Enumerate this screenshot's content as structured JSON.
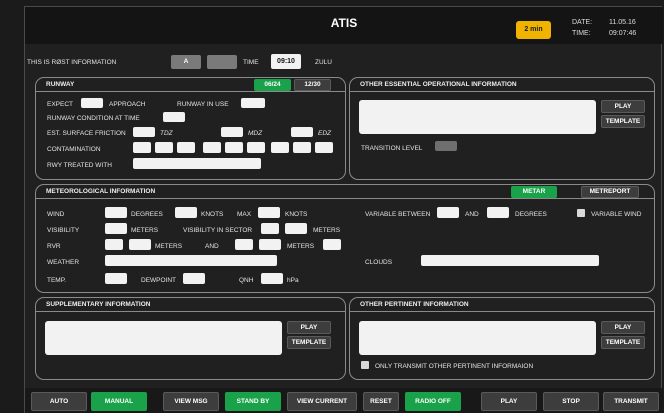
{
  "title": "ATIS",
  "badge": "2 min",
  "date_label": "DATE:",
  "date_value": "11.05.16",
  "time_label": "TIME:",
  "time_value": "09:07:46",
  "info_row": {
    "prefix": "THIS IS RØST INFORMATION",
    "info_letter": "A",
    "time_label": "TIME",
    "time_value": "09:10",
    "zulu": "ZULU"
  },
  "runway": {
    "title": "RUNWAY",
    "rwy_a": "06/24",
    "rwy_b": "12/30",
    "expect": "EXPECT",
    "approach": "APPROACH",
    "in_use": "RUNWAY IN USE",
    "condition": "RUNWAY CONDITION AT TIME",
    "friction": "EST. SURFACE FRICTION",
    "tdz": "TDZ",
    "mdz": "MDZ",
    "edz": "EDZ",
    "contamination": "CONTAMINATION",
    "treated": "RWY TREATED WITH"
  },
  "other_essential": {
    "title": "OTHER ESSENTIAL OPERATIONAL INFORMATION",
    "play": "PLAY",
    "template": "TEMPLATE",
    "transition": "TRANSITION LEVEL"
  },
  "met": {
    "title": "METEOROLOGICAL INFORMATION",
    "metar": "METAR",
    "metreport": "METREPORT",
    "wind": "WIND",
    "degrees": "DEGREES",
    "knots": "KNOTS",
    "max": "MAX",
    "knots2": "KNOTS",
    "variable_between": "VARIABLE BETWEEN",
    "and": "AND",
    "degrees2": "DEGREES",
    "variable_wind": "VARIABLE WIND",
    "visibility": "VISIBILITY",
    "meters": "METERS",
    "vis_sector": "VISIBILITY IN SECTOR",
    "meters2": "METERS",
    "rvr": "RVR",
    "meters3": "METERS",
    "and2": "AND",
    "meters4": "METERS",
    "weather": "WEATHER",
    "clouds": "CLOUDS",
    "temp": "TEMP.",
    "dewpoint": "DEWPOINT",
    "qnh": "QNH",
    "hpa": "hPa"
  },
  "supplementary": {
    "title": "SUPPLEMENTARY INFORMATION",
    "play": "PLAY",
    "template": "TEMPLATE"
  },
  "pertinent": {
    "title": "OTHER PERTINENT INFORMATION",
    "play": "PLAY",
    "template": "TEMPLATE",
    "only_transmit": "ONLY TRANSMIT OTHER PERTINENT INFORMAION"
  },
  "bottom": {
    "auto": "AUTO",
    "manual": "MANUAL",
    "view_msg": "VIEW MSG",
    "stand_by": "STAND BY",
    "view_current": "VIEW CURRENT",
    "reset": "RESET",
    "radio_off": "RADIO OFF",
    "play": "PLAY",
    "stop": "STOP",
    "transmit": "TRANSMIT"
  },
  "colors": {
    "accent_green": "#1aa24a",
    "badge_yellow": "#f0b400"
  }
}
